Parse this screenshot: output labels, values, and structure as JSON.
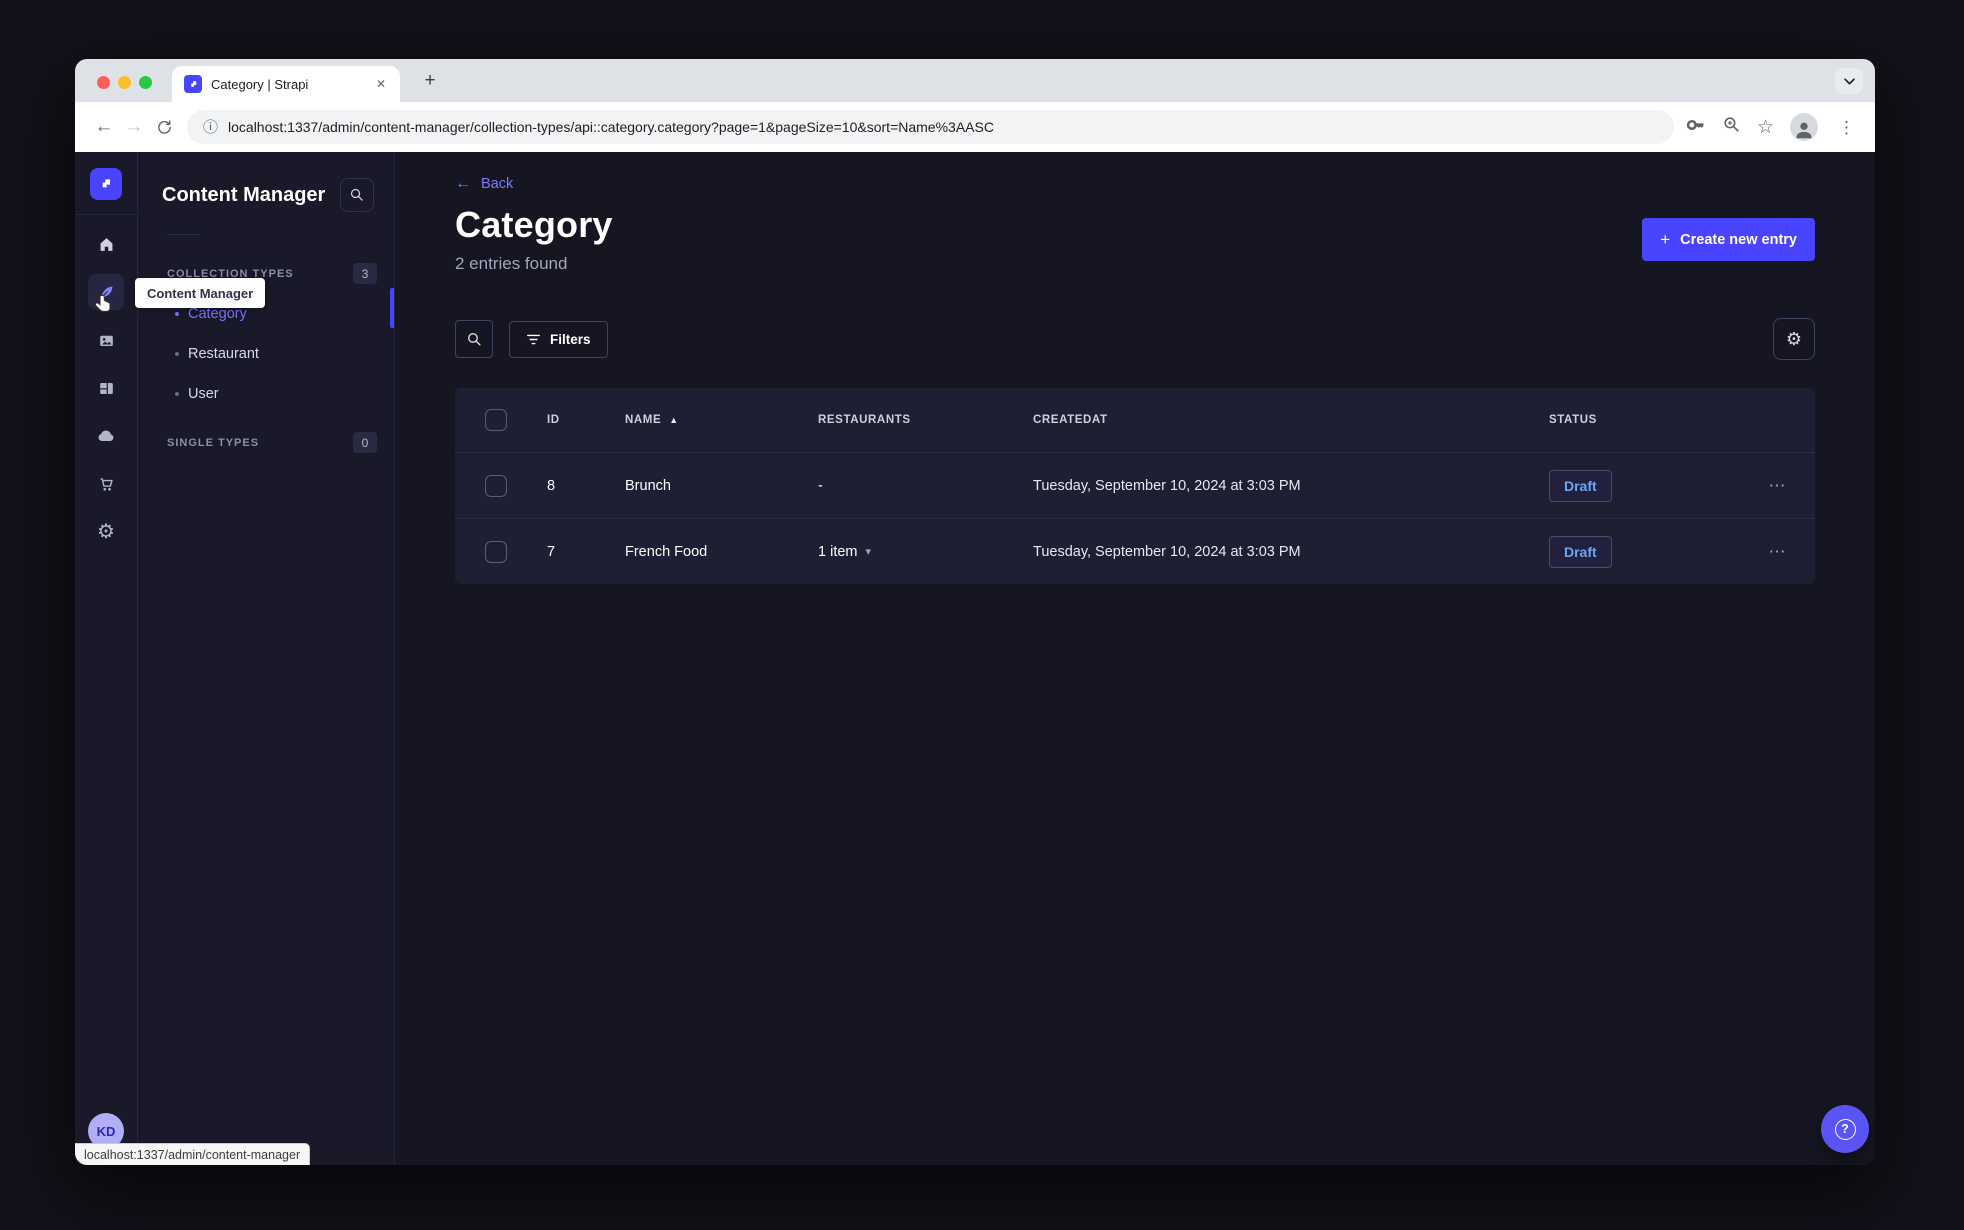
{
  "browser": {
    "tab": {
      "title": "Category | Strapi",
      "close_icon": "✕",
      "new_tab_icon": "+"
    },
    "toolbar": {
      "back_icon": "←",
      "forward_icon": "→",
      "info_icon": "ⓘ",
      "url": "localhost:1337/admin/content-manager/collection-types/api::category.category?page=1&pageSize=10&sort=Name%3AASC",
      "star_icon": "☆",
      "kebab_icon": "⋮"
    },
    "status_bar_link": "localhost:1337/admin/content-manager"
  },
  "colors": {
    "accent": "#4945ff",
    "link": "#7b79ff",
    "draft_text": "#6ba6f8"
  },
  "nav_rail": {
    "tooltip": "Content Manager",
    "user_initials": "KD",
    "gear_icon": "⚙"
  },
  "side_panel": {
    "title": "Content Manager",
    "collection_types": {
      "label": "COLLECTION TYPES",
      "count": "3",
      "items": [
        {
          "label": "Category"
        },
        {
          "label": "Restaurant"
        },
        {
          "label": "User"
        }
      ]
    },
    "single_types": {
      "label": "SINGLE TYPES",
      "count": "0"
    }
  },
  "main": {
    "back_label": "Back",
    "title": "Category",
    "subtitle": "2 entries found",
    "create_button": "Create new entry",
    "filters_button": "Filters",
    "view_settings_icon": "⚙",
    "table": {
      "columns": {
        "id": "ID",
        "name": "NAME",
        "restaurants": "RESTAURANTS",
        "createdat": "CREATEDAT",
        "status": "STATUS"
      },
      "rows": [
        {
          "id": "8",
          "name": "Brunch",
          "restaurants": "-",
          "createdat": "Tuesday, September 10, 2024 at 3:03 PM",
          "status": "Draft"
        },
        {
          "id": "7",
          "name": "French Food",
          "restaurants": "1 item",
          "createdat": "Tuesday, September 10, 2024 at 3:03 PM",
          "status": "Draft"
        }
      ]
    }
  },
  "icons": {
    "sort_asc": "▲",
    "caret_down": "▾",
    "row_actions": "⋯",
    "plus": "+",
    "back_arrow": "←",
    "help": "?"
  }
}
